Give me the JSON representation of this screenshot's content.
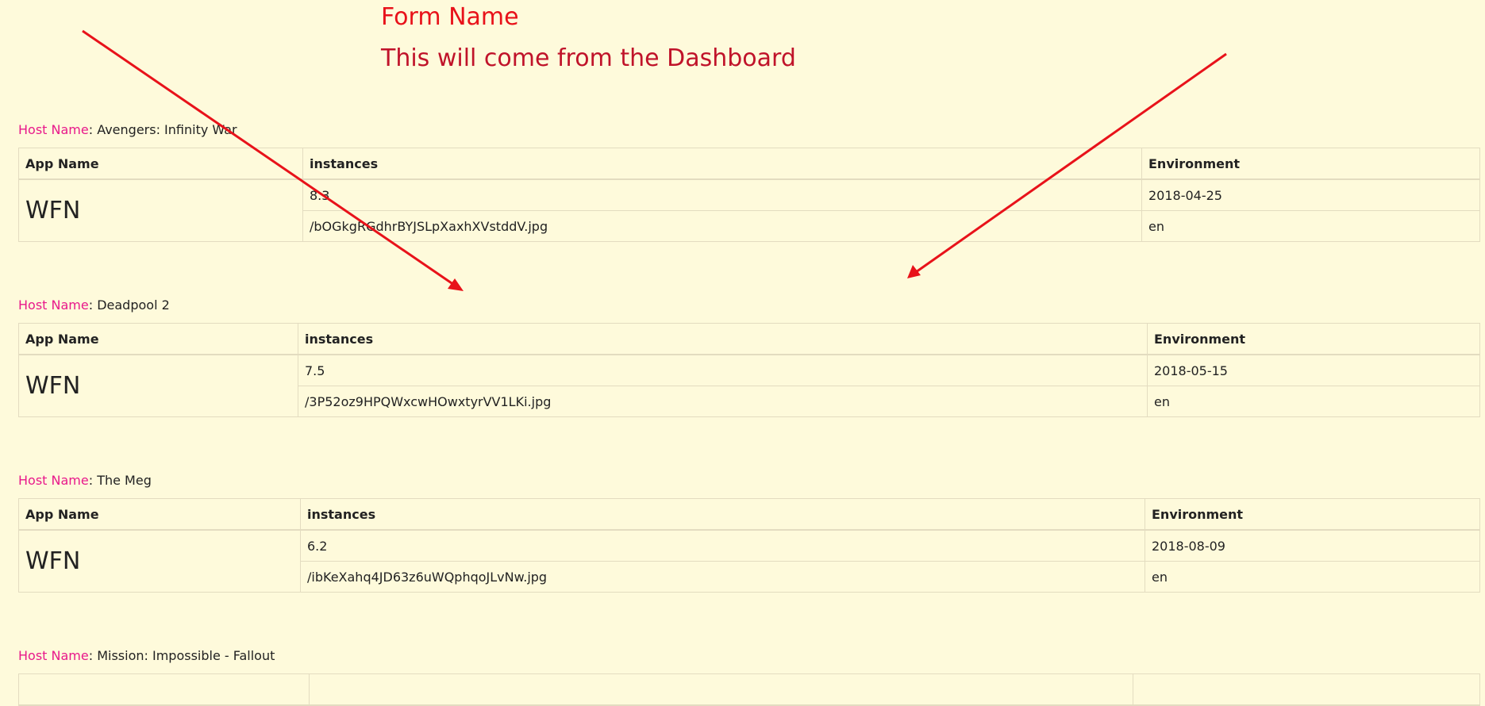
{
  "form": {
    "title": "Form Name",
    "subtitle": "This will come from the Dashboard"
  },
  "host_label": "Host Name",
  "table_headers": {
    "app_name": "App Name",
    "instances": "instances",
    "environment": "Environment"
  },
  "hosts": [
    {
      "name": "Avengers: Infinity War",
      "app": "WFN",
      "instance_version": "8.3",
      "instance_image": "/bOGkgRGdhrBYJSLpXaxhXVstddV.jpg",
      "env_date": "2018-04-25",
      "env_lang": "en"
    },
    {
      "name": "Deadpool 2",
      "app": "WFN",
      "instance_version": "7.5",
      "instance_image": "/3P52oz9HPQWxcwHOwxtyrVV1LKi.jpg",
      "env_date": "2018-05-15",
      "env_lang": "en"
    },
    {
      "name": "The Meg",
      "app": "WFN",
      "instance_version": "6.2",
      "instance_image": "/ibKeXahq4JD63z6uWQphqoJLvNw.jpg",
      "env_date": "2018-08-09",
      "env_lang": "en"
    },
    {
      "name": "Mission: Impossible - Fallout"
    }
  ],
  "annotation": {
    "arrow_color": "#e8121a"
  }
}
